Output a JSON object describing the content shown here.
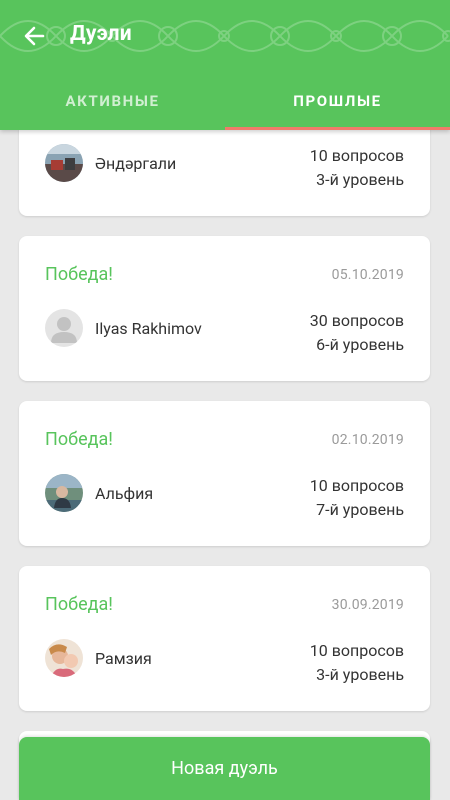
{
  "header": {
    "title": "Дуэли",
    "tabs": [
      {
        "label": "АКТИВНЫЕ",
        "active": false
      },
      {
        "label": "ПРОШЛЫЕ",
        "active": true
      }
    ]
  },
  "duels": [
    {
      "result": "",
      "date": "",
      "opponent": "Әндәргали",
      "questions": "10 вопросов",
      "level": "3-й уровень"
    },
    {
      "result": "Победа!",
      "date": "05.10.2019",
      "opponent": "Ilyas Rakhimov",
      "questions": "30 вопросов",
      "level": "6-й уровень"
    },
    {
      "result": "Победа!",
      "date": "02.10.2019",
      "opponent": "Альфия",
      "questions": "10 вопросов",
      "level": "7-й уровень"
    },
    {
      "result": "Победа!",
      "date": "30.09.2019",
      "opponent": "Рамзия",
      "questions": "10 вопросов",
      "level": "3-й уровень"
    }
  ],
  "new_duel_label": "Новая дуэль",
  "colors": {
    "primary": "#58c45c",
    "tab_indicator": "#f07b6a",
    "background": "#e9e9e9"
  }
}
